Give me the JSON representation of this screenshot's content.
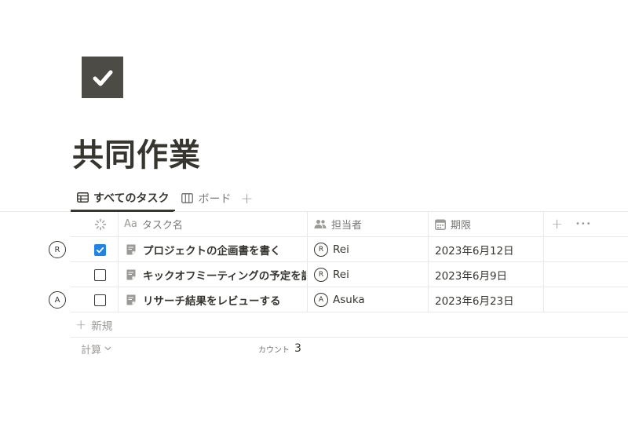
{
  "page": {
    "icon": "checkmark-icon",
    "title": "共同作業"
  },
  "views": {
    "tabs": [
      {
        "label": "すべてのタスク",
        "icon": "table-icon",
        "active": true
      },
      {
        "label": "ボード",
        "icon": "board-icon",
        "active": false
      }
    ],
    "add": "+"
  },
  "table": {
    "columns": [
      {
        "label": "",
        "icon": "status-loader-icon"
      },
      {
        "label": "タスク名",
        "icon_text": "Aa"
      },
      {
        "label": "担当者",
        "icon": "people-icon"
      },
      {
        "label": "期限",
        "icon": "calendar-icon"
      }
    ],
    "header_add": "+",
    "header_more": "•••",
    "rows": [
      {
        "comment_avatar": "R",
        "done": true,
        "task": "プロジェクトの企画書を書く",
        "assignee_initial": "R",
        "assignee": "Rei",
        "due": "2023年6月12日"
      },
      {
        "comment_avatar": "",
        "done": false,
        "task": "キックオフミーティングの予定を調整",
        "assignee_initial": "R",
        "assignee": "Rei",
        "due": "2023年6月9日"
      },
      {
        "comment_avatar": "A",
        "done": false,
        "task": "リサーチ結果をレビューする",
        "assignee_initial": "A",
        "assignee": "Asuka",
        "due": "2023年6月23日"
      }
    ],
    "new_row": "新規",
    "calc_label": "計算",
    "count_label": "カウント",
    "count_value": "3"
  },
  "colors": {
    "text": "#37352f",
    "muted": "#9b9a97",
    "checkbox_checked": "#2383e2",
    "icon_bg": "#4d4b46"
  }
}
